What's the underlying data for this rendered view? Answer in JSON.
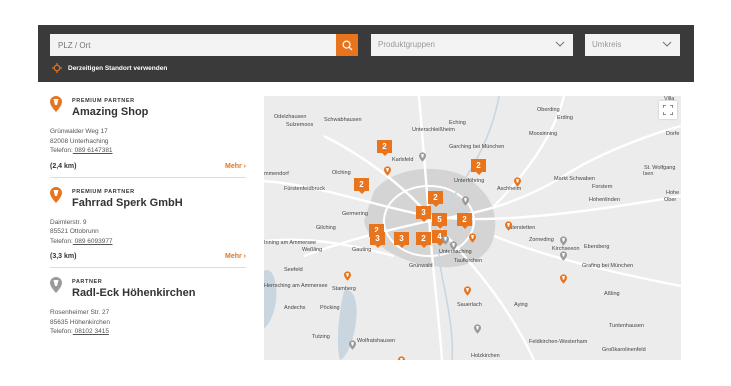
{
  "search": {
    "plz_placeholder": "PLZ / Ort",
    "produkt_label": "Produktgruppen",
    "umkreis_label": "Umkreis",
    "locate_label": "Derzeitigen Standort verwenden"
  },
  "dealers": [
    {
      "tier": "PREMIUM PARTNER",
      "name": "Amazing Shop",
      "street": "Grünwalder Weg 17",
      "city": "82008 Unterhaching",
      "tel_label": "Telefon:",
      "tel": " 089 6147381",
      "distance": "(2,4 km)",
      "more": "Mehr ›"
    },
    {
      "tier": "PREMIUM PARTNER",
      "name": "Fahrrad Sperk GmbH",
      "street": "Daimlerstr. 9",
      "city": "85521 Ottobrunn",
      "tel_label": "Telefon:",
      "tel": " 089 6093977",
      "distance": "(3,3 km)",
      "more": "Mehr ›"
    },
    {
      "tier": "PARTNER",
      "name": "Radl-Eck Höhenkirchen",
      "street": "Rosenheimer Str. 27",
      "city": "85635 Höhenkirchen",
      "tel_label": "Telefon:",
      "tel": " 08102 3415"
    }
  ],
  "map": {
    "places": [
      "Odelzhausen",
      "Sulzemoos",
      "Schwabhausen",
      "Eching",
      "Unterschleißheim",
      "Oberding",
      "Erding",
      "Moosinning",
      "Garching bei München",
      "Karlsfeld",
      "Olching",
      "Fürstenfeldbruck",
      "Unterföhring",
      "Aschheim",
      "Markt Schwaben",
      "Forstern",
      "Hohenlinden",
      "Isen",
      "St. Wolfgang",
      "Germering",
      "Gilching",
      "Weßling",
      "Gauting",
      "Vaterstetten",
      "Zorneding",
      "Kirchseeon",
      "Ebersberg",
      "Grafing bei München",
      "Seefeld",
      "Stamberg",
      "Pöcking",
      "Andechs",
      "Grünwald",
      "Taufkirchen",
      "Unterhaching",
      "Sauerlach",
      "Aying",
      "Feldkirchen-Westerham",
      "Tutzing",
      "Wolfratshausen",
      "Holzkirchen",
      "Großkarolinenfeld",
      "Tuntenhausen",
      "Aßling",
      "mmendorf",
      "Herrsching am Ammersee",
      "Inning am Ammersee",
      "Villa",
      "Dorfe",
      "Hohe",
      "Ober"
    ],
    "clusters": [
      "2",
      "2",
      "2",
      "2",
      "2",
      "3",
      "5",
      "2",
      "3",
      "2",
      "3",
      "4"
    ]
  },
  "colors": {
    "accent": "#e8741e",
    "header_bg": "#3a3a3a"
  }
}
